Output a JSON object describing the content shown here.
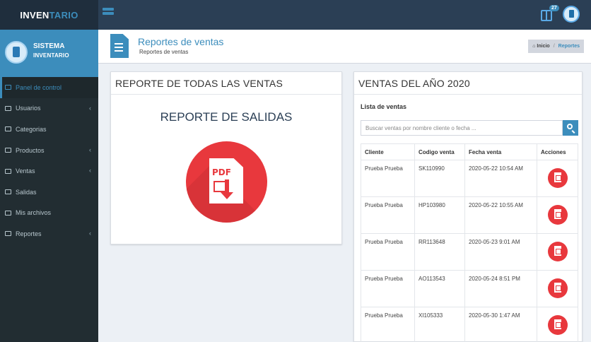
{
  "app": {
    "logo_part1": "INVEN",
    "logo_part2": "TARIO"
  },
  "topbar": {
    "notification_count": "27"
  },
  "user_panel": {
    "name": "SISTEMA",
    "subtitle": "INVENTARIO"
  },
  "sidebar": {
    "items": [
      {
        "label": "Panel de control",
        "icon": "dashboard-icon",
        "active": true,
        "submenu": false
      },
      {
        "label": "Usuarios",
        "icon": "users-icon",
        "active": false,
        "submenu": true
      },
      {
        "label": "Categorias",
        "icon": "categories-icon",
        "active": false,
        "submenu": false
      },
      {
        "label": "Productos",
        "icon": "products-icon",
        "active": false,
        "submenu": true
      },
      {
        "label": "Ventas",
        "icon": "sales-icon",
        "active": false,
        "submenu": true
      },
      {
        "label": "Salidas",
        "icon": "outputs-icon",
        "active": false,
        "submenu": false
      },
      {
        "label": "Mis archivos",
        "icon": "files-icon",
        "active": false,
        "submenu": false
      },
      {
        "label": "Reportes",
        "icon": "reports-icon",
        "active": false,
        "submenu": true
      }
    ]
  },
  "header": {
    "title": "Reportes de ventas",
    "subtitle": "Reportes de ventas",
    "breadcrumb": {
      "home": "Inicio",
      "current": "Reportes"
    }
  },
  "left_box": {
    "title": "REPORTE DE TODAS LAS VENTAS",
    "heading": "REPORTE DE SALIDAS",
    "pdf_label": "PDF"
  },
  "right_box": {
    "title": "VENTAS DEL AÑO 2020",
    "list_title": "Lista de ventas",
    "search_placeholder": "Buscar ventas por nombre cliente o fecha ...",
    "columns": [
      "Cliente",
      "Codigo venta",
      "Fecha venta",
      "Acciones"
    ],
    "rows": [
      {
        "cliente": "Prueba Prueba",
        "codigo": "SK110990",
        "fecha": "2020-05-22 10:54 AM"
      },
      {
        "cliente": "Prueba Prueba",
        "codigo": "HP103980",
        "fecha": "2020-05-22 10:55 AM"
      },
      {
        "cliente": "Prueba Prueba",
        "codigo": "RR113648",
        "fecha": "2020-05-23 9:01 AM"
      },
      {
        "cliente": "Prueba Prueba",
        "codigo": "AO113543",
        "fecha": "2020-05-24 8:51 PM"
      },
      {
        "cliente": "Prueba Prueba",
        "codigo": "XI105333",
        "fecha": "2020-05-30 1:47 AM"
      }
    ]
  },
  "colors": {
    "primary": "#3c8dbc",
    "sidebar": "#222d32",
    "topbar": "#2b3f55",
    "pdf_red": "#e8383d"
  }
}
